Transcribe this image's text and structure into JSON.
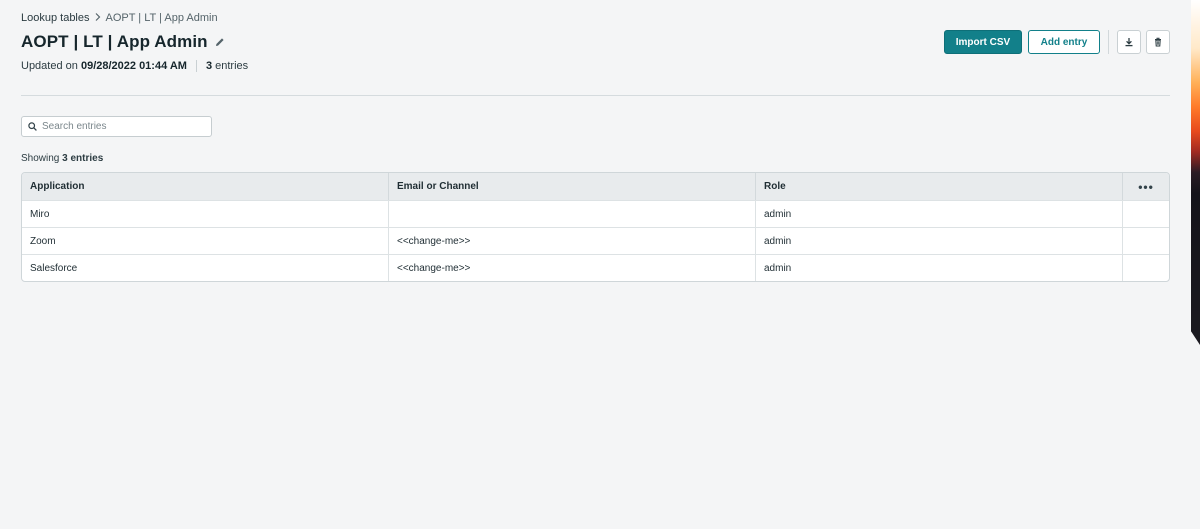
{
  "breadcrumb": {
    "parent": "Lookup tables",
    "current": "AOPT | LT | App Admin"
  },
  "header": {
    "title": "AOPT | LT | App Admin",
    "updated_prefix": "Updated on",
    "updated_at": "09/28/2022 01:44 AM",
    "entries_count": "3",
    "entries_suffix": "entries"
  },
  "actions": {
    "import_label": "Import CSV",
    "add_label": "Add entry"
  },
  "search": {
    "placeholder": "Search entries"
  },
  "showing": {
    "prefix": "Showing",
    "count_text": "3 entries"
  },
  "table": {
    "columns": [
      "Application",
      "Email or Channel",
      "Role"
    ],
    "more_label": "•••",
    "rows": [
      [
        "Miro",
        "",
        "admin"
      ],
      [
        "Zoom",
        "<<change-me>>",
        "admin"
      ],
      [
        "Salesforce",
        "<<change-me>>",
        "admin"
      ]
    ]
  },
  "colors": {
    "accent": "#12808a",
    "background": "#f4f5f6",
    "table_header": "#e8ebed"
  }
}
